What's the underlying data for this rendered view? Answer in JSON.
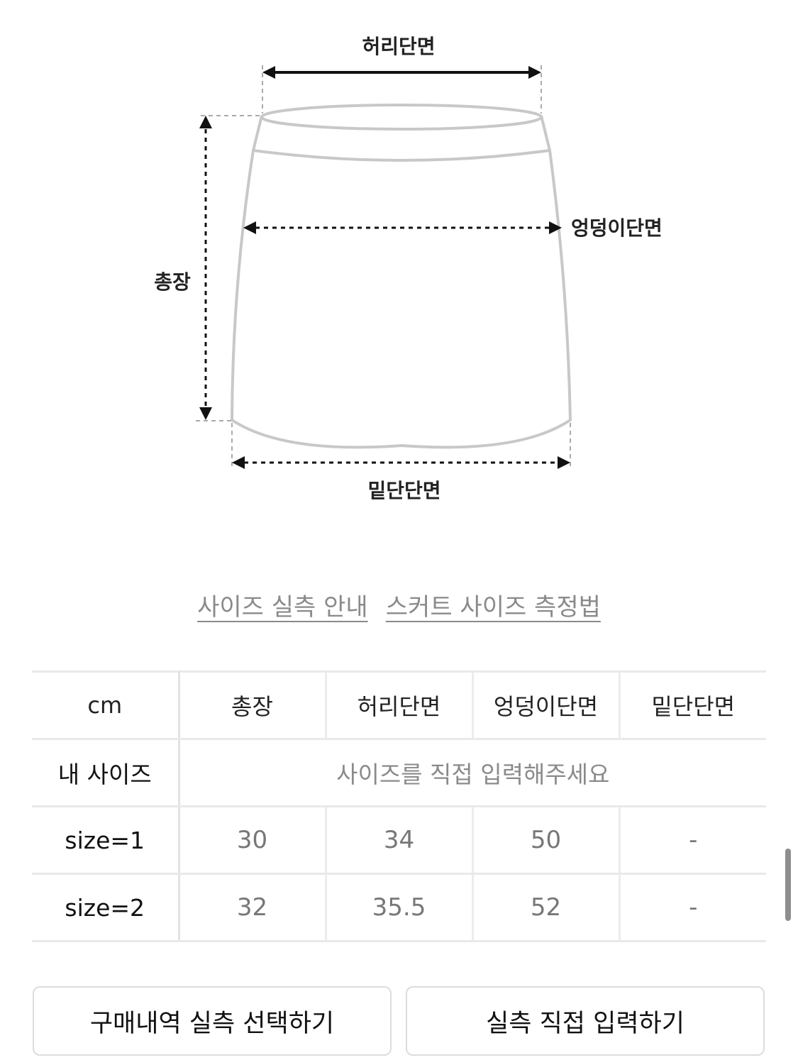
{
  "diagram": {
    "waist_label": "허리단면",
    "hip_label": "엉덩이단면",
    "length_label": "총장",
    "hem_label": "밑단단면"
  },
  "links": {
    "size_guide": "사이즈 실측 안내",
    "skirt_measure": "스커트 사이즈 측정법"
  },
  "table": {
    "headers": [
      "cm",
      "총장",
      "허리단면",
      "엉덩이단면",
      "밑단단면"
    ],
    "my_size": {
      "label": "내 사이즈",
      "placeholder": "사이즈를 직접 입력해주세요"
    },
    "rows": [
      {
        "label": "size=1",
        "values": [
          "30",
          "34",
          "50",
          "-"
        ]
      },
      {
        "label": "size=2",
        "values": [
          "32",
          "35.5",
          "52",
          "-"
        ]
      }
    ]
  },
  "buttons": {
    "purchase_history": "구매내역 실측 선택하기",
    "direct_input": "실측 직접 입력하기"
  },
  "icons": [
    "arrow-icon",
    "scrollbar"
  ],
  "colors": {
    "link_gray": "#8a8a8a",
    "border": "#e9e9e9",
    "outline": "#c8c8c8"
  }
}
